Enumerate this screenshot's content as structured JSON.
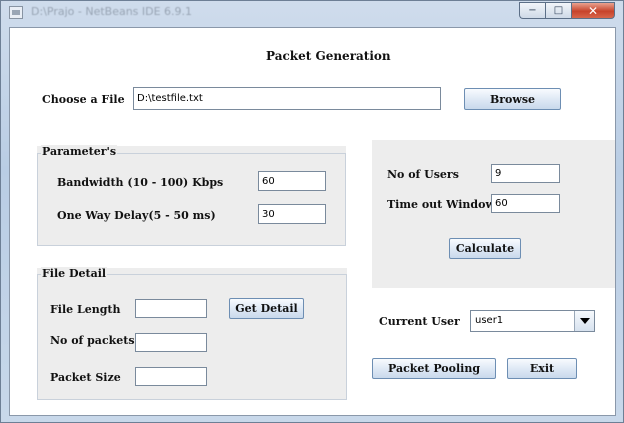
{
  "window": {
    "title": "D:\\Prajo - NetBeans IDE 6.9.1",
    "controls": {
      "minimize": "−",
      "maximize": "□",
      "close": "✕"
    }
  },
  "header": {
    "title": "Packet Generation"
  },
  "file_chooser": {
    "label": "Choose a File",
    "path": "D:\\testfile.txt",
    "browse_label": "Browse"
  },
  "parameters": {
    "legend": "Parameter's",
    "bandwidth_label": "Bandwidth (10 - 100) Kbps",
    "bandwidth_value": "60",
    "delay_label": "One Way Delay(5 - 50 ms)",
    "delay_value": "30"
  },
  "users_panel": {
    "users_label": "No of Users",
    "users_value": "9",
    "timeout_label": "Time out Window",
    "timeout_value": "60",
    "calculate_label": "Calculate"
  },
  "file_detail": {
    "legend": "File Detail",
    "length_label": "File Length",
    "length_value": "",
    "packets_label": "No of packets",
    "packets_value": "",
    "size_label": "Packet Size",
    "size_value": "",
    "get_detail_label": "Get Detail"
  },
  "current_user": {
    "label": "Current User",
    "selected": "user1"
  },
  "actions": {
    "packet_pooling_label": "Packet Pooling",
    "exit_label": "Exit"
  }
}
